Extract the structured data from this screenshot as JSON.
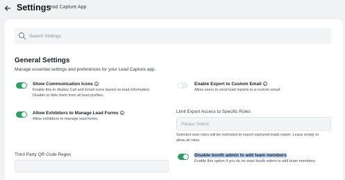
{
  "header": {
    "back_icon": "arrow-left-icon",
    "title": "Settings",
    "app_name": "Lead Capture App"
  },
  "search": {
    "placeholder": "Search Settings",
    "value": "",
    "icon": "search-icon"
  },
  "general": {
    "title": "General Settings",
    "description": "Manage essential settings and preferences for your Lead Capture app."
  },
  "settings": {
    "show_comm_icons": {
      "label": "Show Communication Icons",
      "desc_line1": "Enable this to display Call and Email icons based on lead information.",
      "desc_line2": "Disable to hide them from all lead profiles.",
      "enabled": true
    },
    "export_custom_email": {
      "label": "Enable Export to Custom Email",
      "desc": "Allow users to send lead reports to a custom email.",
      "enabled": false
    },
    "exhibitors_lead_forms": {
      "label": "Allow Exhibitors to Manage Lead Forms",
      "desc": "Allow exhibitors to manage lead forms.",
      "enabled": true
    },
    "limit_export": {
      "label": "Limit Export Access to Specific Roles",
      "placeholder": "Please Select",
      "help_line1": "Selected user roles will be restricted to export captured leads report. Leave empty to",
      "help_line2": "allow all roles."
    },
    "qr_regex": {
      "label": "Third Party QR Code Regex",
      "value": ""
    },
    "disable_booth_admin": {
      "label": "Disable booth admin to add team members",
      "desc": "Enable this option if you do no want booth admin to add team members.",
      "enabled": true
    }
  },
  "colors": {
    "toggle_on": "#2fa063",
    "toggle_off": "#eceef1",
    "selection_highlight": "#bcd5f5"
  }
}
